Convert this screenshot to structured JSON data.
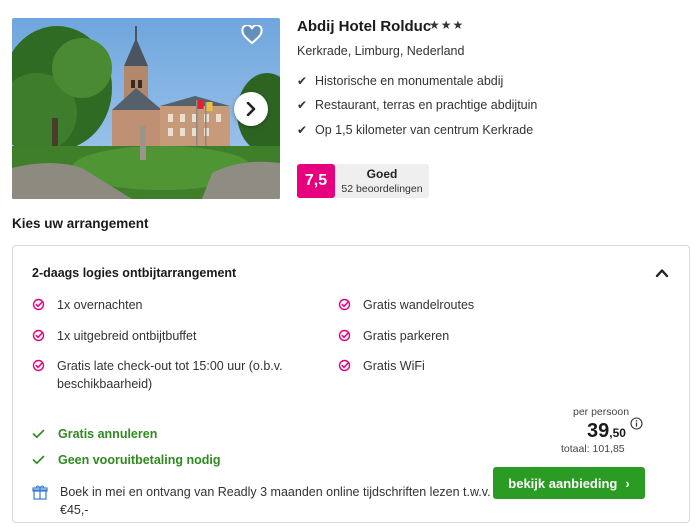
{
  "hotel": {
    "name": "Abdij Hotel Rolduc",
    "stars": "★★★",
    "location": "Kerkrade, Limburg, Nederland",
    "usps": [
      "Historische en monumentale abdij",
      "Restaurant, terras en prachtige abdijtuin",
      "Op 1,5 kilometer van centrum Kerkrade"
    ]
  },
  "rating": {
    "score": "7,5",
    "label": "Goed",
    "reviews": "52 beoordelingen",
    "color": "#e6007e"
  },
  "section_title": "Kies uw arrangement",
  "arrangement": {
    "title": "2-daags logies ontbijtarrangement",
    "features_left": [
      "1x overnachten",
      "1x uitgebreid ontbijtbuffet",
      "Gratis late check-out tot 15:00 uur (o.b.v. beschikbaarheid)"
    ],
    "features_right": [
      "Gratis wandelroutes",
      "Gratis parkeren",
      "Gratis WiFi"
    ],
    "perks": [
      "Gratis annuleren",
      "Geen vooruitbetaling nodig"
    ],
    "promo": "Boek in mei en ontvang van Readly 3 maanden online tijdschriften lezen t.w.v. €45,-",
    "price_label": "per persoon",
    "price_main": "39",
    "price_cents": ",50",
    "total": "totaal: 101,85",
    "cta_label": "bekijk aanbieding",
    "cta_arrow": "›"
  },
  "icons": {
    "favorite": "heart-icon",
    "next": "chevron-right-icon",
    "collapse": "chevron-up-icon",
    "feature": "circle-check-icon",
    "info": "info-icon",
    "promo": "gift-icon"
  },
  "colors": {
    "accent_pink": "#e6007e",
    "green": "#2a9b23",
    "green_text": "#2f8a1f"
  }
}
